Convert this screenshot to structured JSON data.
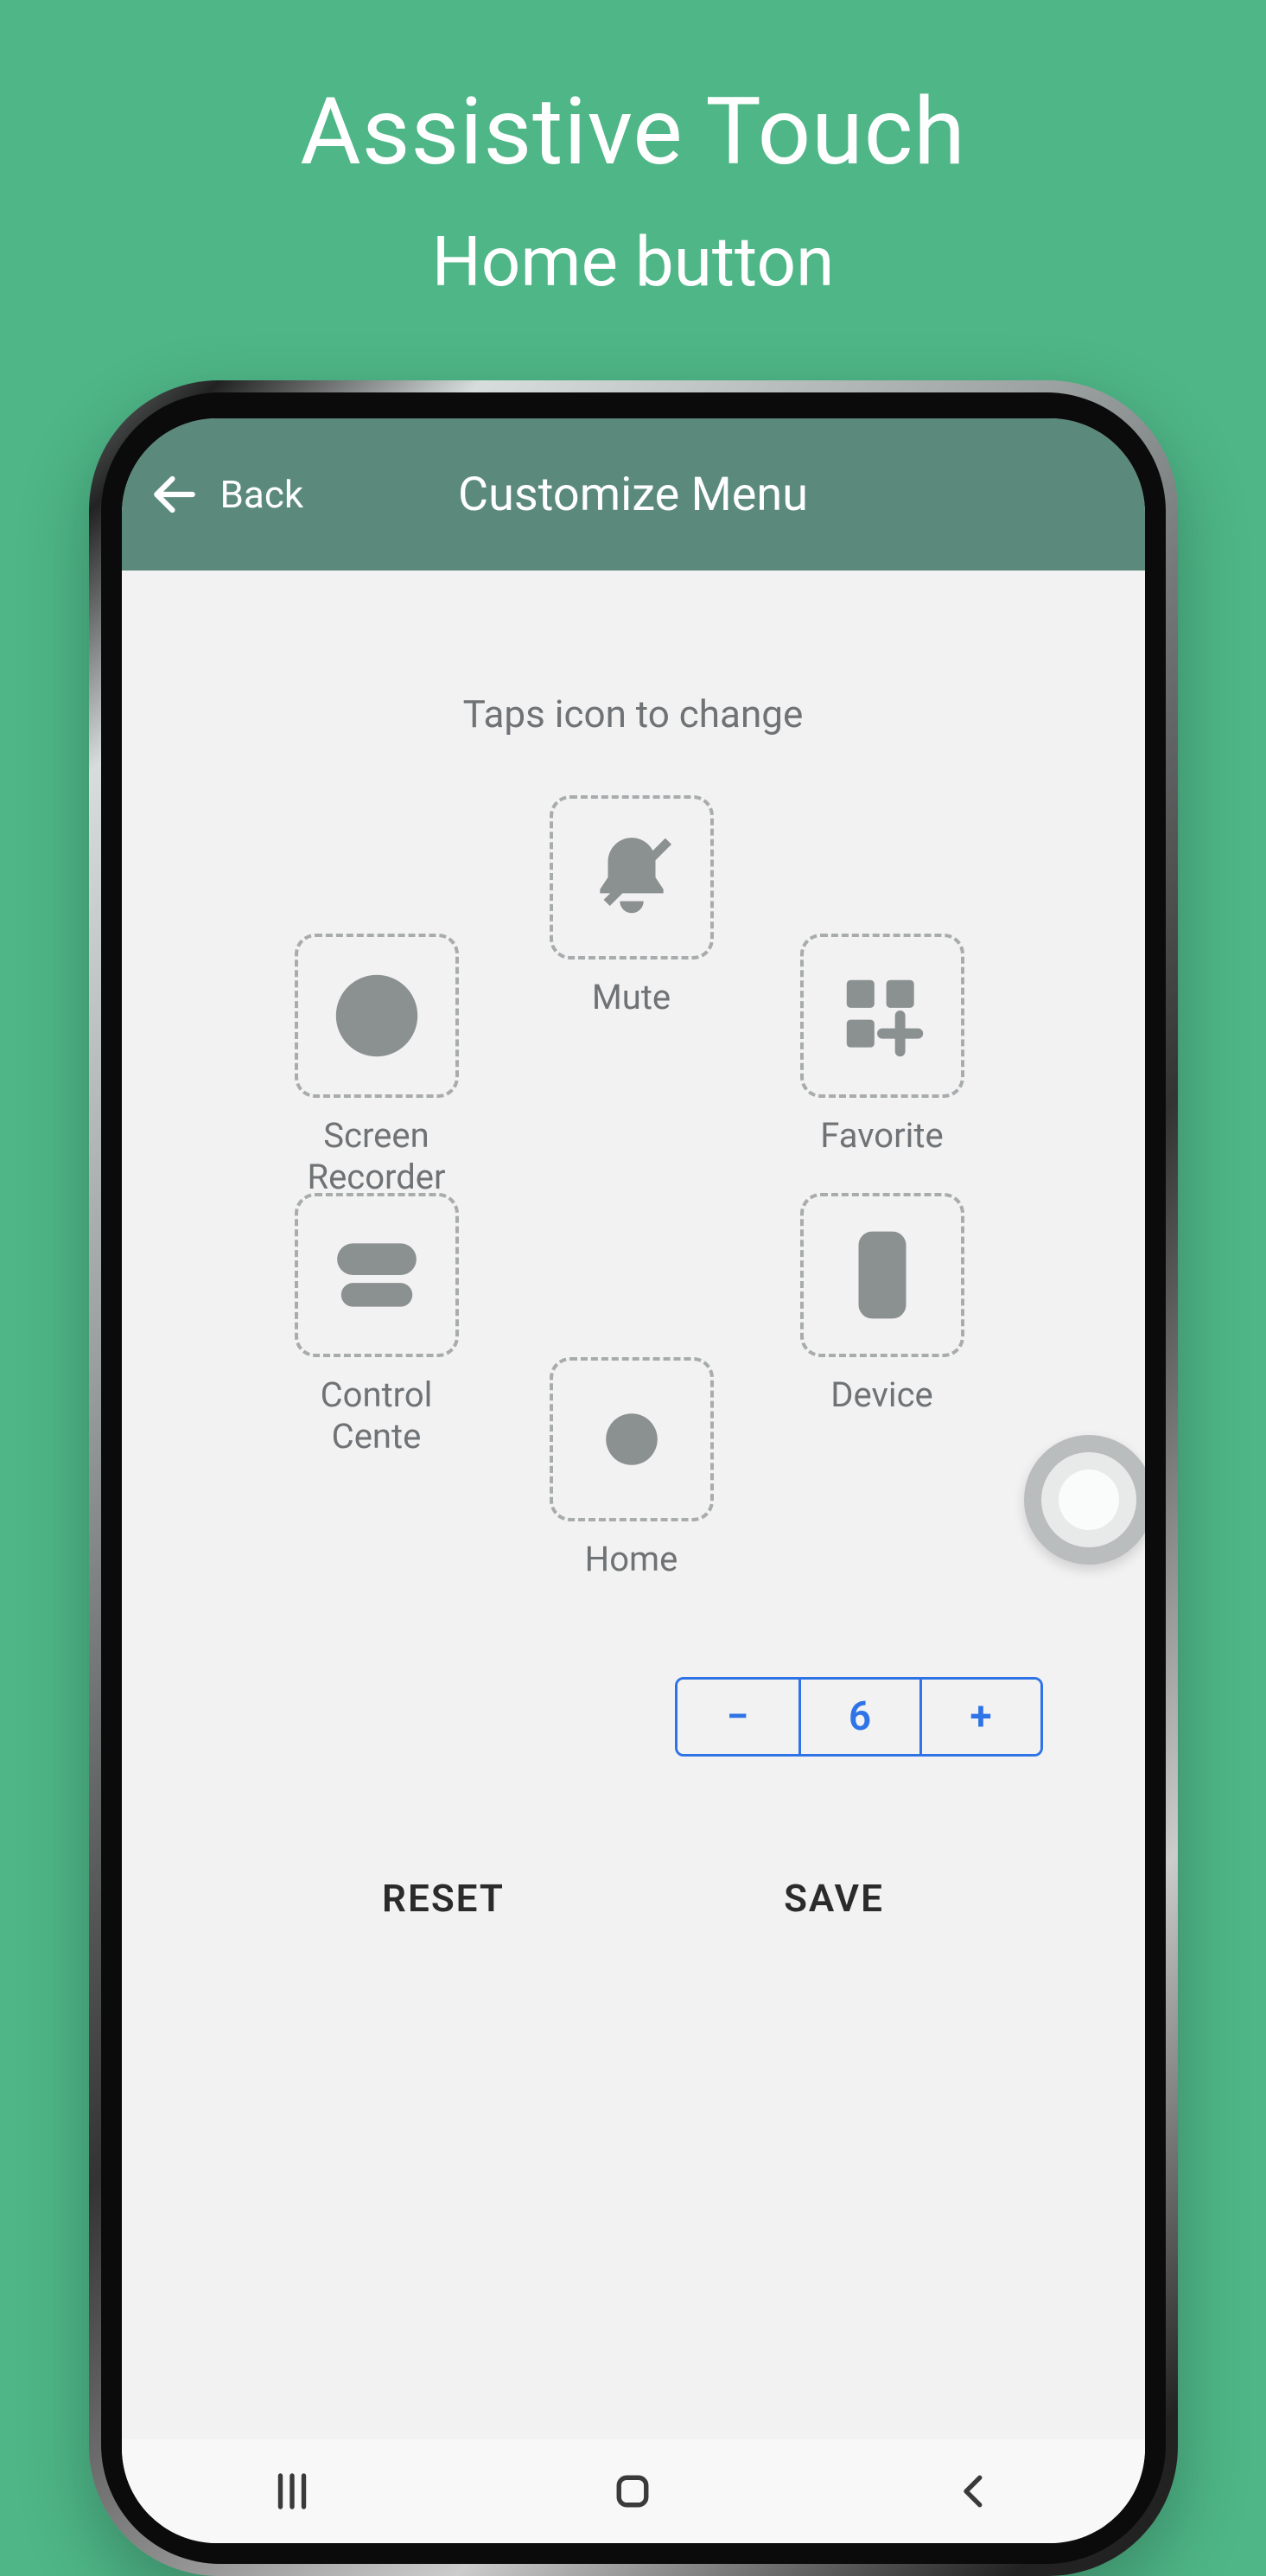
{
  "banner": {
    "title": "Assistive Touch",
    "subtitle": "Home button"
  },
  "header": {
    "back_label": "Back",
    "title": "Customize Menu"
  },
  "content": {
    "hint": "Taps icon to change"
  },
  "slots": {
    "mute": {
      "label": "Mute",
      "icon": "bell-off-icon"
    },
    "screenrec": {
      "label": "Screen\nRecorder",
      "icon": "record-icon"
    },
    "favorite": {
      "label": "Favorite",
      "icon": "apps-add-icon"
    },
    "controlctr": {
      "label": "Control Cente",
      "icon": "toggles-icon"
    },
    "device": {
      "label": "Device",
      "icon": "phone-outline-icon"
    },
    "home": {
      "label": "Home",
      "icon": "home-dot-icon"
    }
  },
  "stepper": {
    "minus": "−",
    "value": "6",
    "plus": "+"
  },
  "buttons": {
    "reset": "RESET",
    "save": "SAVE"
  },
  "colors": {
    "bg": "#4eb687",
    "header": "#5b8a7d",
    "accent": "#2f74e6",
    "muted": "#6f7375"
  }
}
